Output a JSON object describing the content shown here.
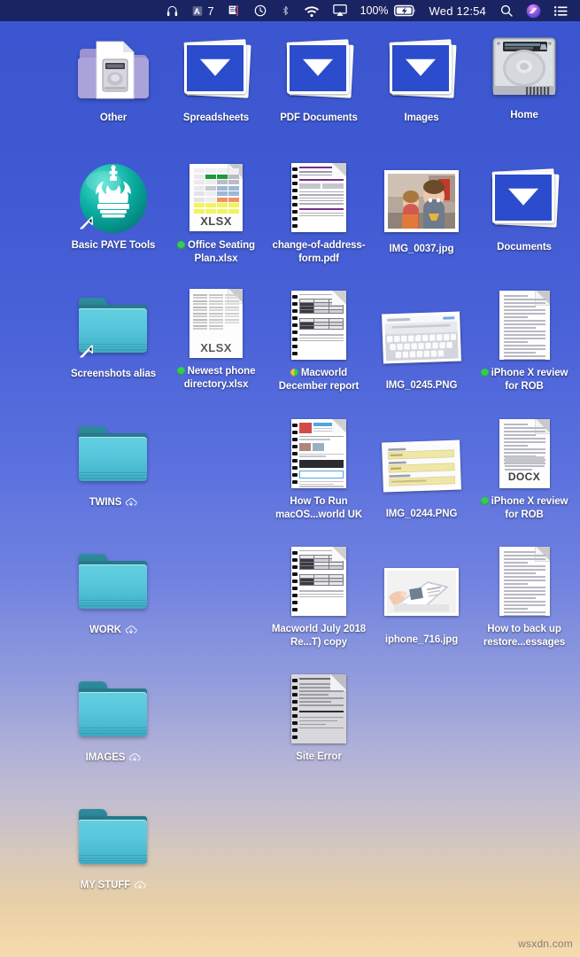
{
  "menubar": {
    "background_color": "#1b2463",
    "items": [
      {
        "name": "headphones-icon",
        "icon": "headphones",
        "label": ""
      },
      {
        "name": "adobe-icon",
        "icon": "adobe-a",
        "label": "7"
      },
      {
        "name": "notification-icon",
        "icon": "flagged-doc",
        "label": ""
      },
      {
        "name": "time-machine-icon",
        "icon": "clock-back",
        "label": ""
      },
      {
        "name": "bluetooth-icon",
        "icon": "bluetooth",
        "label": ""
      },
      {
        "name": "wifi-icon",
        "icon": "wifi",
        "label": ""
      },
      {
        "name": "airplay-icon",
        "icon": "airplay",
        "label": ""
      }
    ],
    "battery_percent": "100%",
    "battery_state": "charging",
    "clock": "Wed 12:54",
    "search_icon": "search-icon",
    "siri_icon": "siri-icon",
    "controlcenter_icon": "notification-center-icon"
  },
  "desktop": {
    "watermark": "wsxdn.com",
    "icons": [
      {
        "label": "Other",
        "type": "other-folder",
        "tag": null,
        "alias": false,
        "cloud": false,
        "col": 0,
        "row": 0
      },
      {
        "label": "Spreadsheets",
        "type": "smart-stack",
        "tag": null,
        "alias": false,
        "cloud": false,
        "col": 1,
        "row": 0
      },
      {
        "label": "PDF Documents",
        "type": "smart-stack",
        "tag": null,
        "alias": false,
        "cloud": false,
        "col": 2,
        "row": 0
      },
      {
        "label": "Images",
        "type": "smart-stack",
        "tag": null,
        "alias": false,
        "cloud": false,
        "col": 3,
        "row": 0
      },
      {
        "label": "Home",
        "type": "hard-drive",
        "tag": null,
        "alias": false,
        "cloud": false,
        "col": 4,
        "row": 0
      },
      {
        "label": "Basic PAYE Tools",
        "type": "paye-app",
        "tag": null,
        "alias": true,
        "cloud": false,
        "col": 0,
        "row": 1
      },
      {
        "label": "Office Seating Plan.xlsx",
        "type": "xlsx-doc",
        "tag": "green",
        "alias": false,
        "cloud": false,
        "col": 1,
        "row": 1
      },
      {
        "label": "change-of-address-form.pdf",
        "type": "bound-form",
        "tag": null,
        "alias": false,
        "cloud": false,
        "col": 2,
        "row": 1
      },
      {
        "label": "IMG_0037.jpg",
        "type": "photo-kids",
        "tag": null,
        "alias": false,
        "cloud": false,
        "col": 3,
        "row": 1
      },
      {
        "label": "Documents",
        "type": "smart-stack",
        "tag": null,
        "alias": false,
        "cloud": false,
        "col": 4,
        "row": 1
      },
      {
        "label": "Screenshots alias",
        "type": "folder",
        "tag": null,
        "alias": true,
        "cloud": false,
        "col": 0,
        "row": 2
      },
      {
        "label": "Newest phone directory.xlsx",
        "type": "xlsx-dense",
        "tag": "green",
        "alias": false,
        "cloud": false,
        "col": 1,
        "row": 2
      },
      {
        "label": "Macworld December report",
        "type": "bound-table",
        "tag": "dual",
        "alias": false,
        "cloud": false,
        "col": 2,
        "row": 2
      },
      {
        "label": "IMG_0245.PNG",
        "type": "photo-keyboard",
        "tag": null,
        "alias": false,
        "cloud": false,
        "col": 3,
        "row": 2
      },
      {
        "label": "iPhone X review for ROB",
        "type": "text-doc",
        "tag": "green",
        "alias": false,
        "cloud": false,
        "col": 4,
        "row": 2
      },
      {
        "label": "TWINS",
        "type": "folder",
        "tag": null,
        "alias": false,
        "cloud": true,
        "col": 0,
        "row": 3
      },
      {
        "label": "How To Run macOS...world UK",
        "type": "bound-web",
        "tag": null,
        "alias": false,
        "cloud": false,
        "col": 2,
        "row": 3
      },
      {
        "label": "IMG_0244.PNG",
        "type": "photo-form",
        "tag": null,
        "alias": false,
        "cloud": false,
        "col": 3,
        "row": 3
      },
      {
        "label": "iPhone X review for ROB",
        "type": "docx-doc",
        "tag": "green",
        "alias": false,
        "cloud": false,
        "col": 4,
        "row": 3
      },
      {
        "label": "WORK",
        "type": "folder",
        "tag": null,
        "alias": false,
        "cloud": true,
        "col": 0,
        "row": 4
      },
      {
        "label": "Macworld July 2018 Re...T) copy",
        "type": "bound-table",
        "tag": null,
        "alias": false,
        "cloud": false,
        "col": 2,
        "row": 4
      },
      {
        "label": "iphone_716.jpg",
        "type": "photo-ipad",
        "tag": null,
        "alias": false,
        "cloud": false,
        "col": 3,
        "row": 4
      },
      {
        "label": "How to back up restore...essages",
        "type": "text-doc",
        "tag": null,
        "alias": false,
        "cloud": false,
        "col": 4,
        "row": 4
      },
      {
        "label": "IMAGES",
        "type": "folder",
        "tag": null,
        "alias": false,
        "cloud": true,
        "col": 0,
        "row": 5
      },
      {
        "label": "Site Error",
        "type": "bound-gray",
        "tag": null,
        "alias": false,
        "cloud": false,
        "col": 2,
        "row": 5
      },
      {
        "label": "MY STUFF",
        "type": "folder",
        "tag": null,
        "alias": false,
        "cloud": true,
        "col": 0,
        "row": 6
      }
    ]
  }
}
